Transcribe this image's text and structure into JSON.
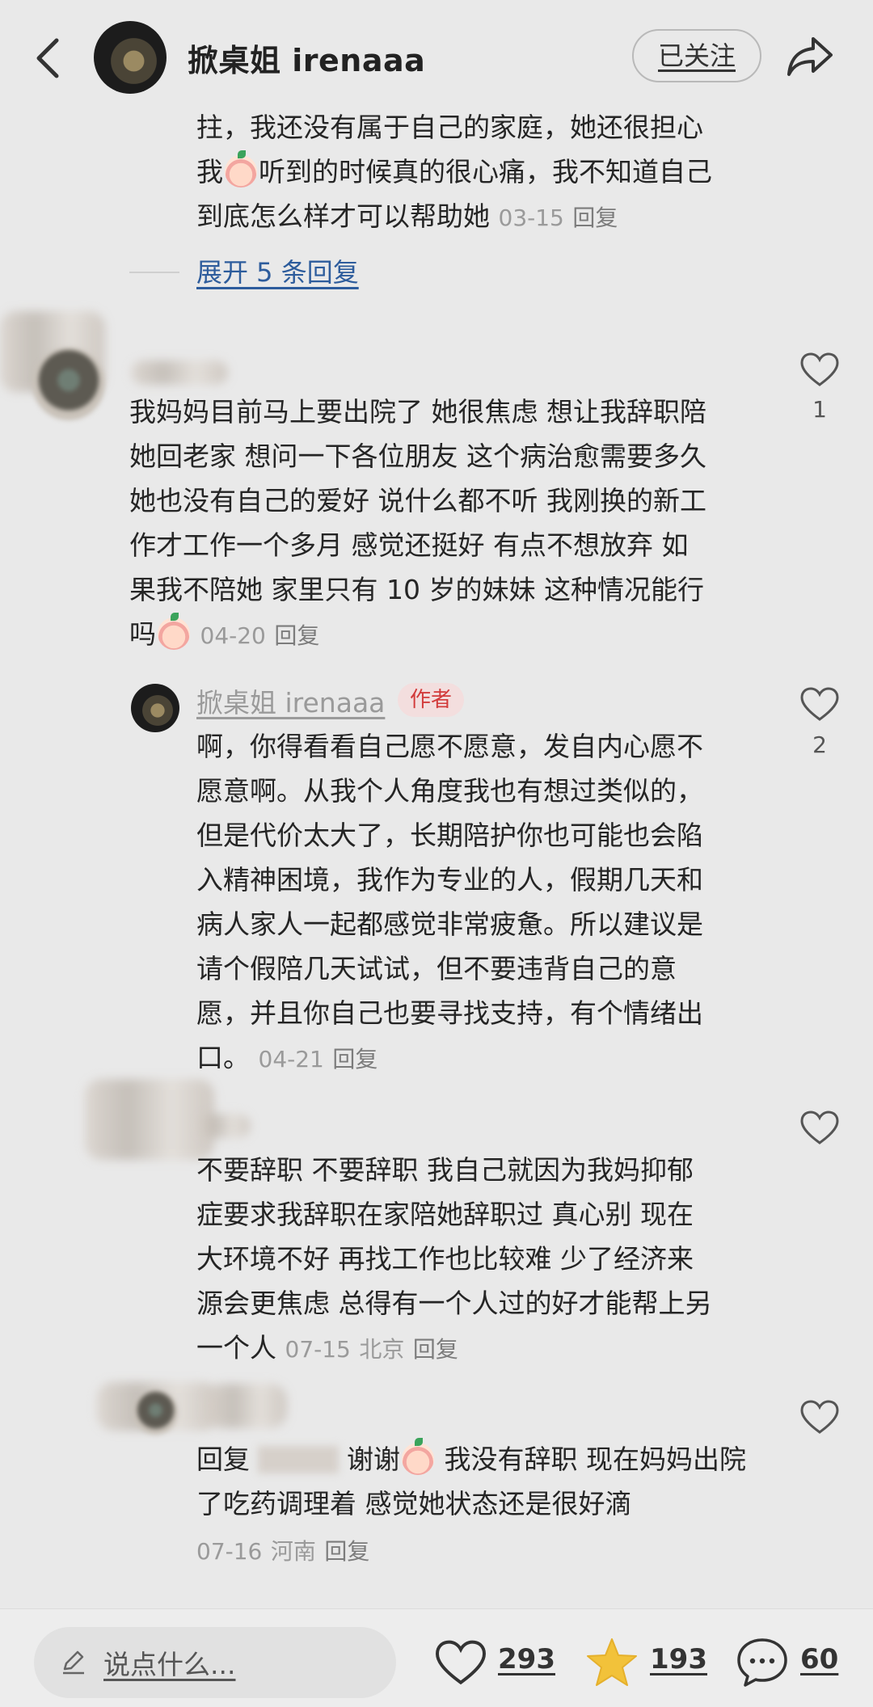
{
  "header": {
    "title": "掀桌姐 irenaaa",
    "follow_label": "已关注"
  },
  "top_comment": {
    "lines": [
      "拄，我还没有属于自己的家庭，她还很担心",
      "我",
      "听到的时候真的很心痛，我不知道自己",
      "到底怎么样才可以帮助她"
    ],
    "date": "03-15",
    "reply": "回复",
    "expand": "展开 5 条回复"
  },
  "comment1": {
    "lines": [
      "我妈妈目前马上要出院了 她很焦虑 想让我辞职陪",
      "她回老家 想问一下各位朋友 这个病治愈需要多久",
      "她也没有自己的爱好 说什么都不听 我刚换的新工",
      "作才工作一个多月 感觉还挺好 有点不想放弃 如",
      "果我不陪她 家里只有 10 岁的妹妹 这种情况能行",
      "吗"
    ],
    "date": "04-20",
    "reply": "回复",
    "likes": "1"
  },
  "reply1": {
    "author": "掀桌姐 irenaaa",
    "badge": "作者",
    "lines": [
      "啊，你得看看自己愿不愿意，发自内心愿不",
      "愿意啊。从我个人角度我也有想过类似的，",
      "但是代价太大了，长期陪护你也可能也会陷",
      "入精神困境，我作为专业的人，假期几天和",
      "病人家人一起都感觉非常疲惫。所以建议是",
      "请个假陪几天试试，但不要违背自己的意",
      "愿，并且你自己也要寻找支持，有个情绪出",
      "口。"
    ],
    "date": "04-21",
    "reply": "回复",
    "likes": "2"
  },
  "reply2": {
    "lines": [
      "不要辞职 不要辞职 我自己就因为我妈抑郁",
      "症要求我辞职在家陪她辞职过 真心别 现在",
      "大环境不好 再找工作也比较难 少了经济来",
      "源会更焦虑 总得有一个人过的好才能帮上另",
      "一个人"
    ],
    "date": "07-15",
    "location": "北京",
    "reply": "回复"
  },
  "reply3": {
    "prefix": "回复",
    "text_a": "谢谢",
    "text_b": "我没有辞职 现在妈妈出院",
    "line2": "了吃药调理着 感觉她状态还是很好滴",
    "date": "07-16",
    "location": "河南",
    "reply": "回复"
  },
  "bottom_bar": {
    "input_placeholder": "说点什么...",
    "likes": "293",
    "stars": "193",
    "comments": "60"
  },
  "colors": {
    "background": "#e9e9e9",
    "link_blue": "#2d5c9c",
    "author_badge": "#d23b3b",
    "star": "#f2c23a"
  },
  "icons": [
    "back-icon",
    "share-icon",
    "heart-icon",
    "pencil-icon",
    "star-icon",
    "comment-bubble-icon"
  ]
}
